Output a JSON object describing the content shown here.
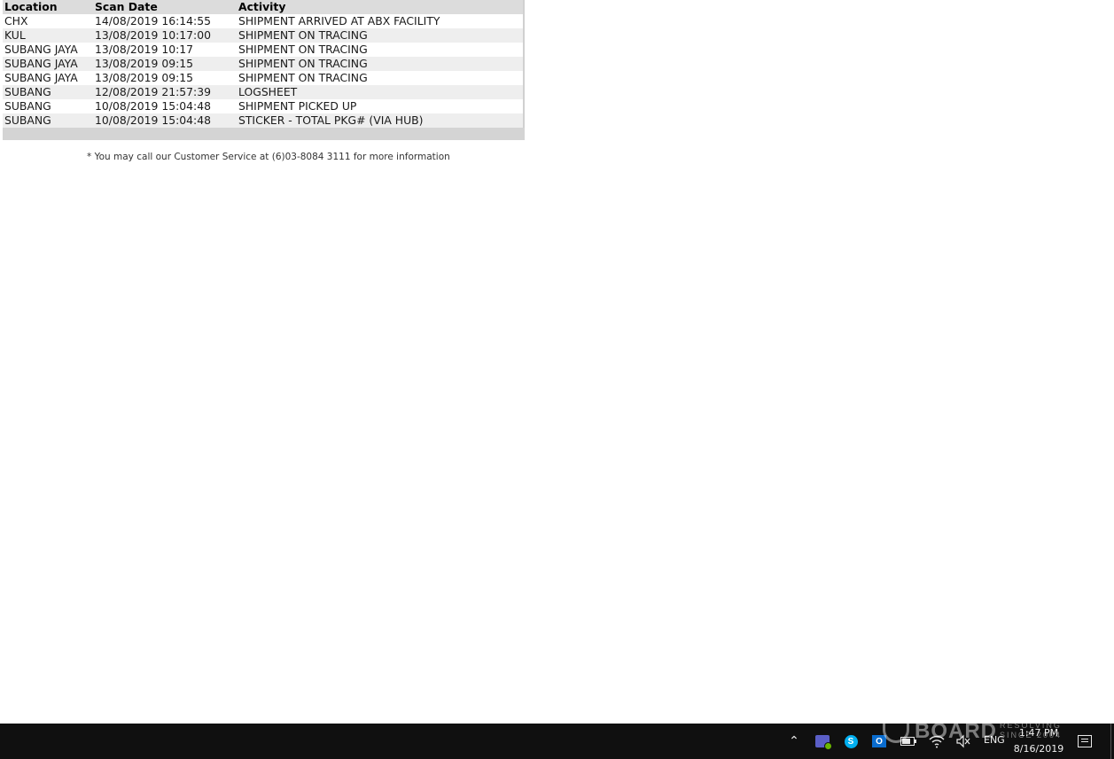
{
  "tracking": {
    "columns": [
      "Location",
      "Scan Date",
      "Activity"
    ],
    "rows": [
      {
        "location": "CHX",
        "scan_date": "14/08/2019 16:14:55",
        "activity": "SHIPMENT ARRIVED AT ABX FACILITY"
      },
      {
        "location": "KUL",
        "scan_date": "13/08/2019 10:17:00",
        "activity": "SHIPMENT ON TRACING"
      },
      {
        "location": "SUBANG JAYA",
        "scan_date": "13/08/2019 10:17",
        "activity": "SHIPMENT ON TRACING"
      },
      {
        "location": "SUBANG JAYA",
        "scan_date": "13/08/2019 09:15",
        "activity": "SHIPMENT ON TRACING"
      },
      {
        "location": "SUBANG JAYA",
        "scan_date": "13/08/2019 09:15",
        "activity": "SHIPMENT ON TRACING"
      },
      {
        "location": "SUBANG",
        "scan_date": "12/08/2019 21:57:39",
        "activity": "LOGSHEET"
      },
      {
        "location": "SUBANG",
        "scan_date": "10/08/2019 15:04:48",
        "activity": "SHIPMENT PICKED UP"
      },
      {
        "location": "SUBANG",
        "scan_date": "10/08/2019 15:04:48",
        "activity": "STICKER - TOTAL PKG# (VIA HUB)"
      }
    ],
    "note": "* You may call our Customer Service at (6)03-8084 3111 for more information"
  },
  "taskbar": {
    "language": "ENG",
    "time": "1:47 PM",
    "date": "8/16/2019",
    "icons": [
      "chevron-up-icon",
      "teams-icon",
      "skype-icon",
      "outlook-icon",
      "battery-icon",
      "wifi-icon",
      "volume-muted-icon",
      "notification-icon"
    ]
  },
  "watermark": {
    "brand": "BOARD",
    "tagline_1": "RESOLVING",
    "tagline_2": "SINCE 2004"
  }
}
